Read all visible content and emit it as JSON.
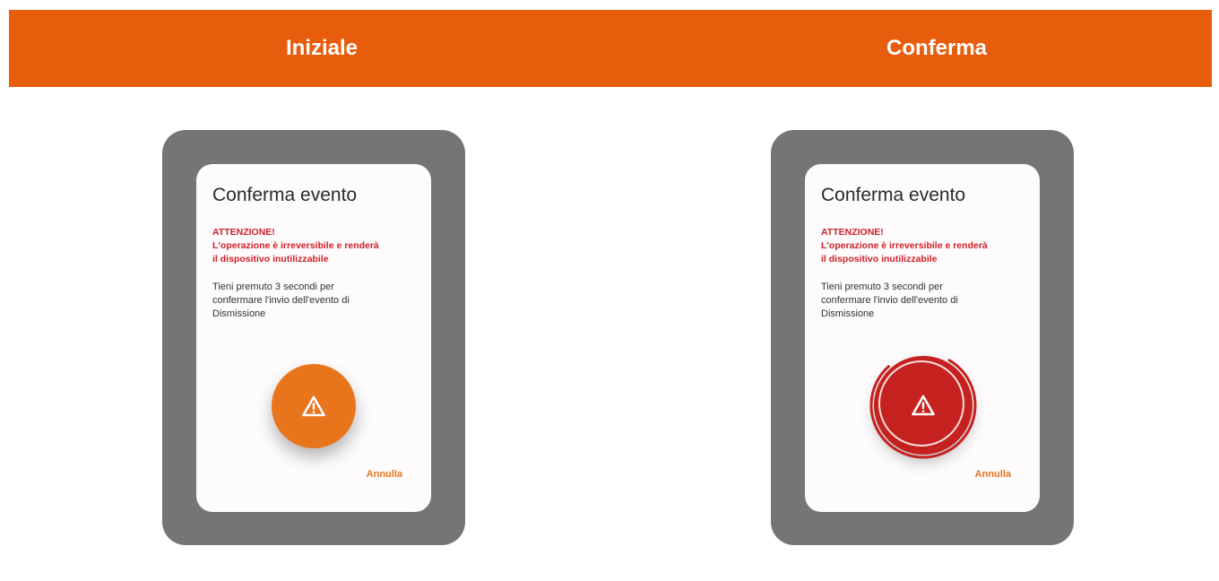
{
  "header": {
    "left_label": "Iniziale",
    "right_label": "Conferma",
    "background_color": "#e85d0c"
  },
  "screens": [
    {
      "state": "Iniziale",
      "dialog_title": "Conferma evento",
      "warning_lines": [
        "ATTENZIONE!",
        "L'operazione è irreversibile e renderà",
        "il dispositivo inutilizzabile"
      ],
      "body_lines": [
        "Tieni premuto 3 secondi per",
        "confermare l'invio dell'evento di",
        "Dismissione"
      ],
      "button_icon": "warning-triangle-icon",
      "button_color": "#e8741c",
      "cancel_label": "Annulla"
    },
    {
      "state": "Conferma",
      "dialog_title": "Conferma evento",
      "warning_lines": [
        "ATTENZIONE!",
        "L'operazione è irreversibile e renderà",
        "il dispositivo inutilizzabile"
      ],
      "body_lines": [
        "Tieni premuto 3 secondi per",
        "confermare l'invio dell'evento di",
        "Dismissione"
      ],
      "button_icon": "warning-triangle-icon",
      "button_color": "#c5221f",
      "hold_progress": 0.8,
      "cancel_label": "Annulla"
    }
  ]
}
